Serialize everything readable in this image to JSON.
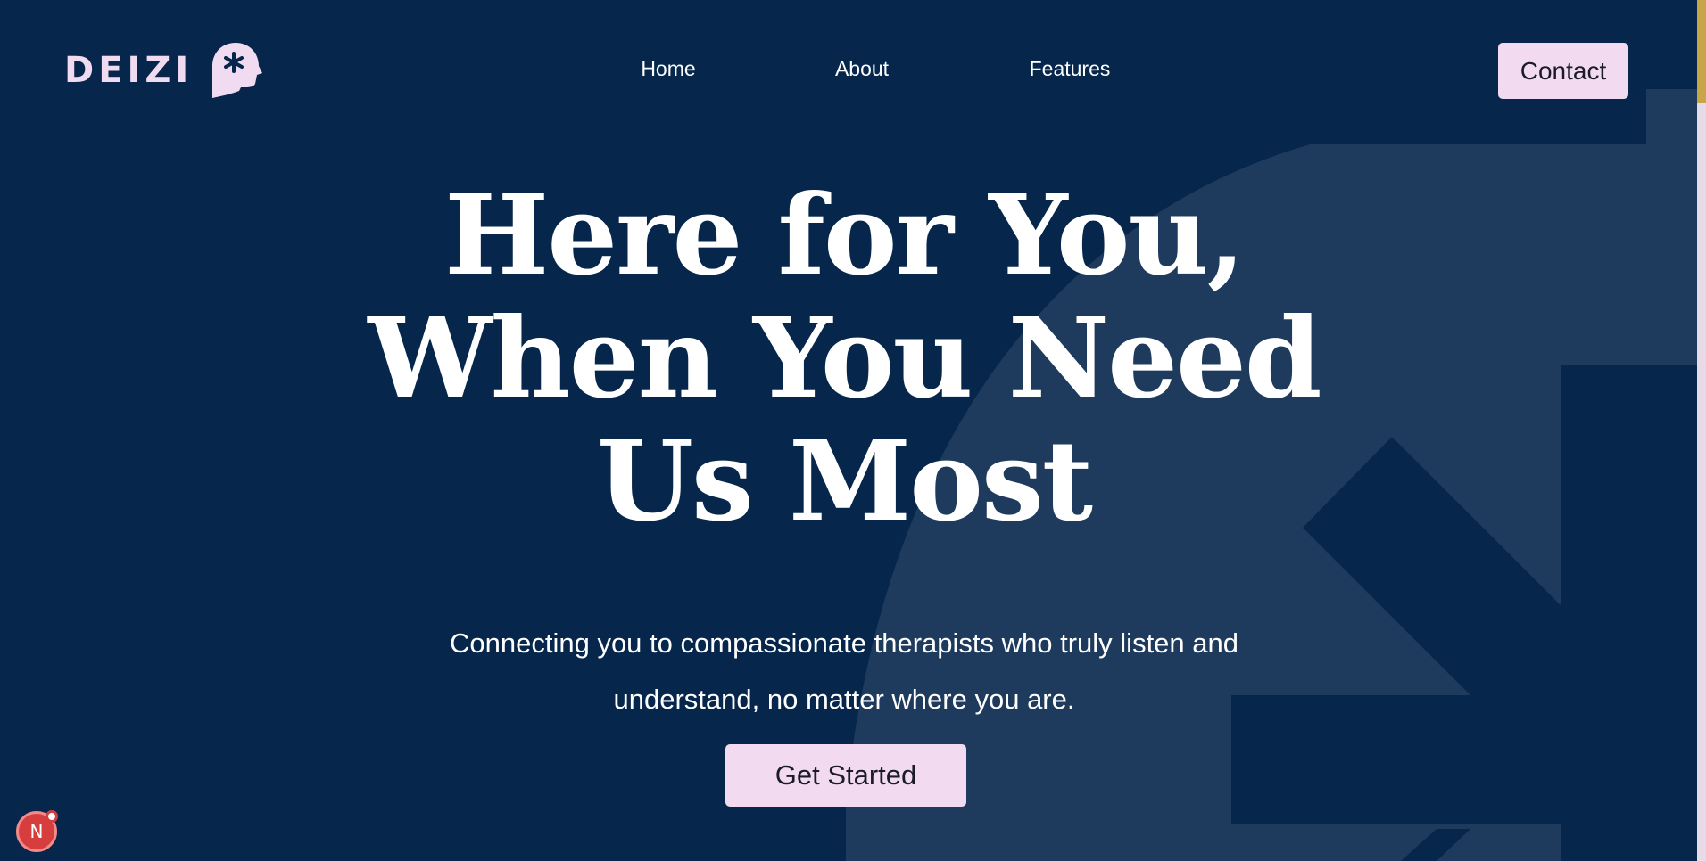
{
  "brand": {
    "name": "DEIZI",
    "logo_icon": "head-asterisk-icon"
  },
  "nav": {
    "items": [
      {
        "label": "Home"
      },
      {
        "label": "About"
      },
      {
        "label": "Features"
      }
    ],
    "contact_label": "Contact"
  },
  "hero": {
    "title_lines": [
      "Here for You,",
      "When You Need",
      "Us Most"
    ],
    "subtitle_lines": [
      "Connecting you to compassionate therapists who truly listen and",
      "understand, no matter where you are."
    ],
    "cta_label": "Get Started"
  },
  "badge": {
    "label": "N",
    "icon": "nextjs-dev-icon"
  },
  "colors": {
    "background": "#06264b",
    "background_art": "#1e3a5c",
    "accent": "#f2dbf1",
    "button_text": "#1c1b2b",
    "scroll_thumb": "#c9a54a"
  }
}
